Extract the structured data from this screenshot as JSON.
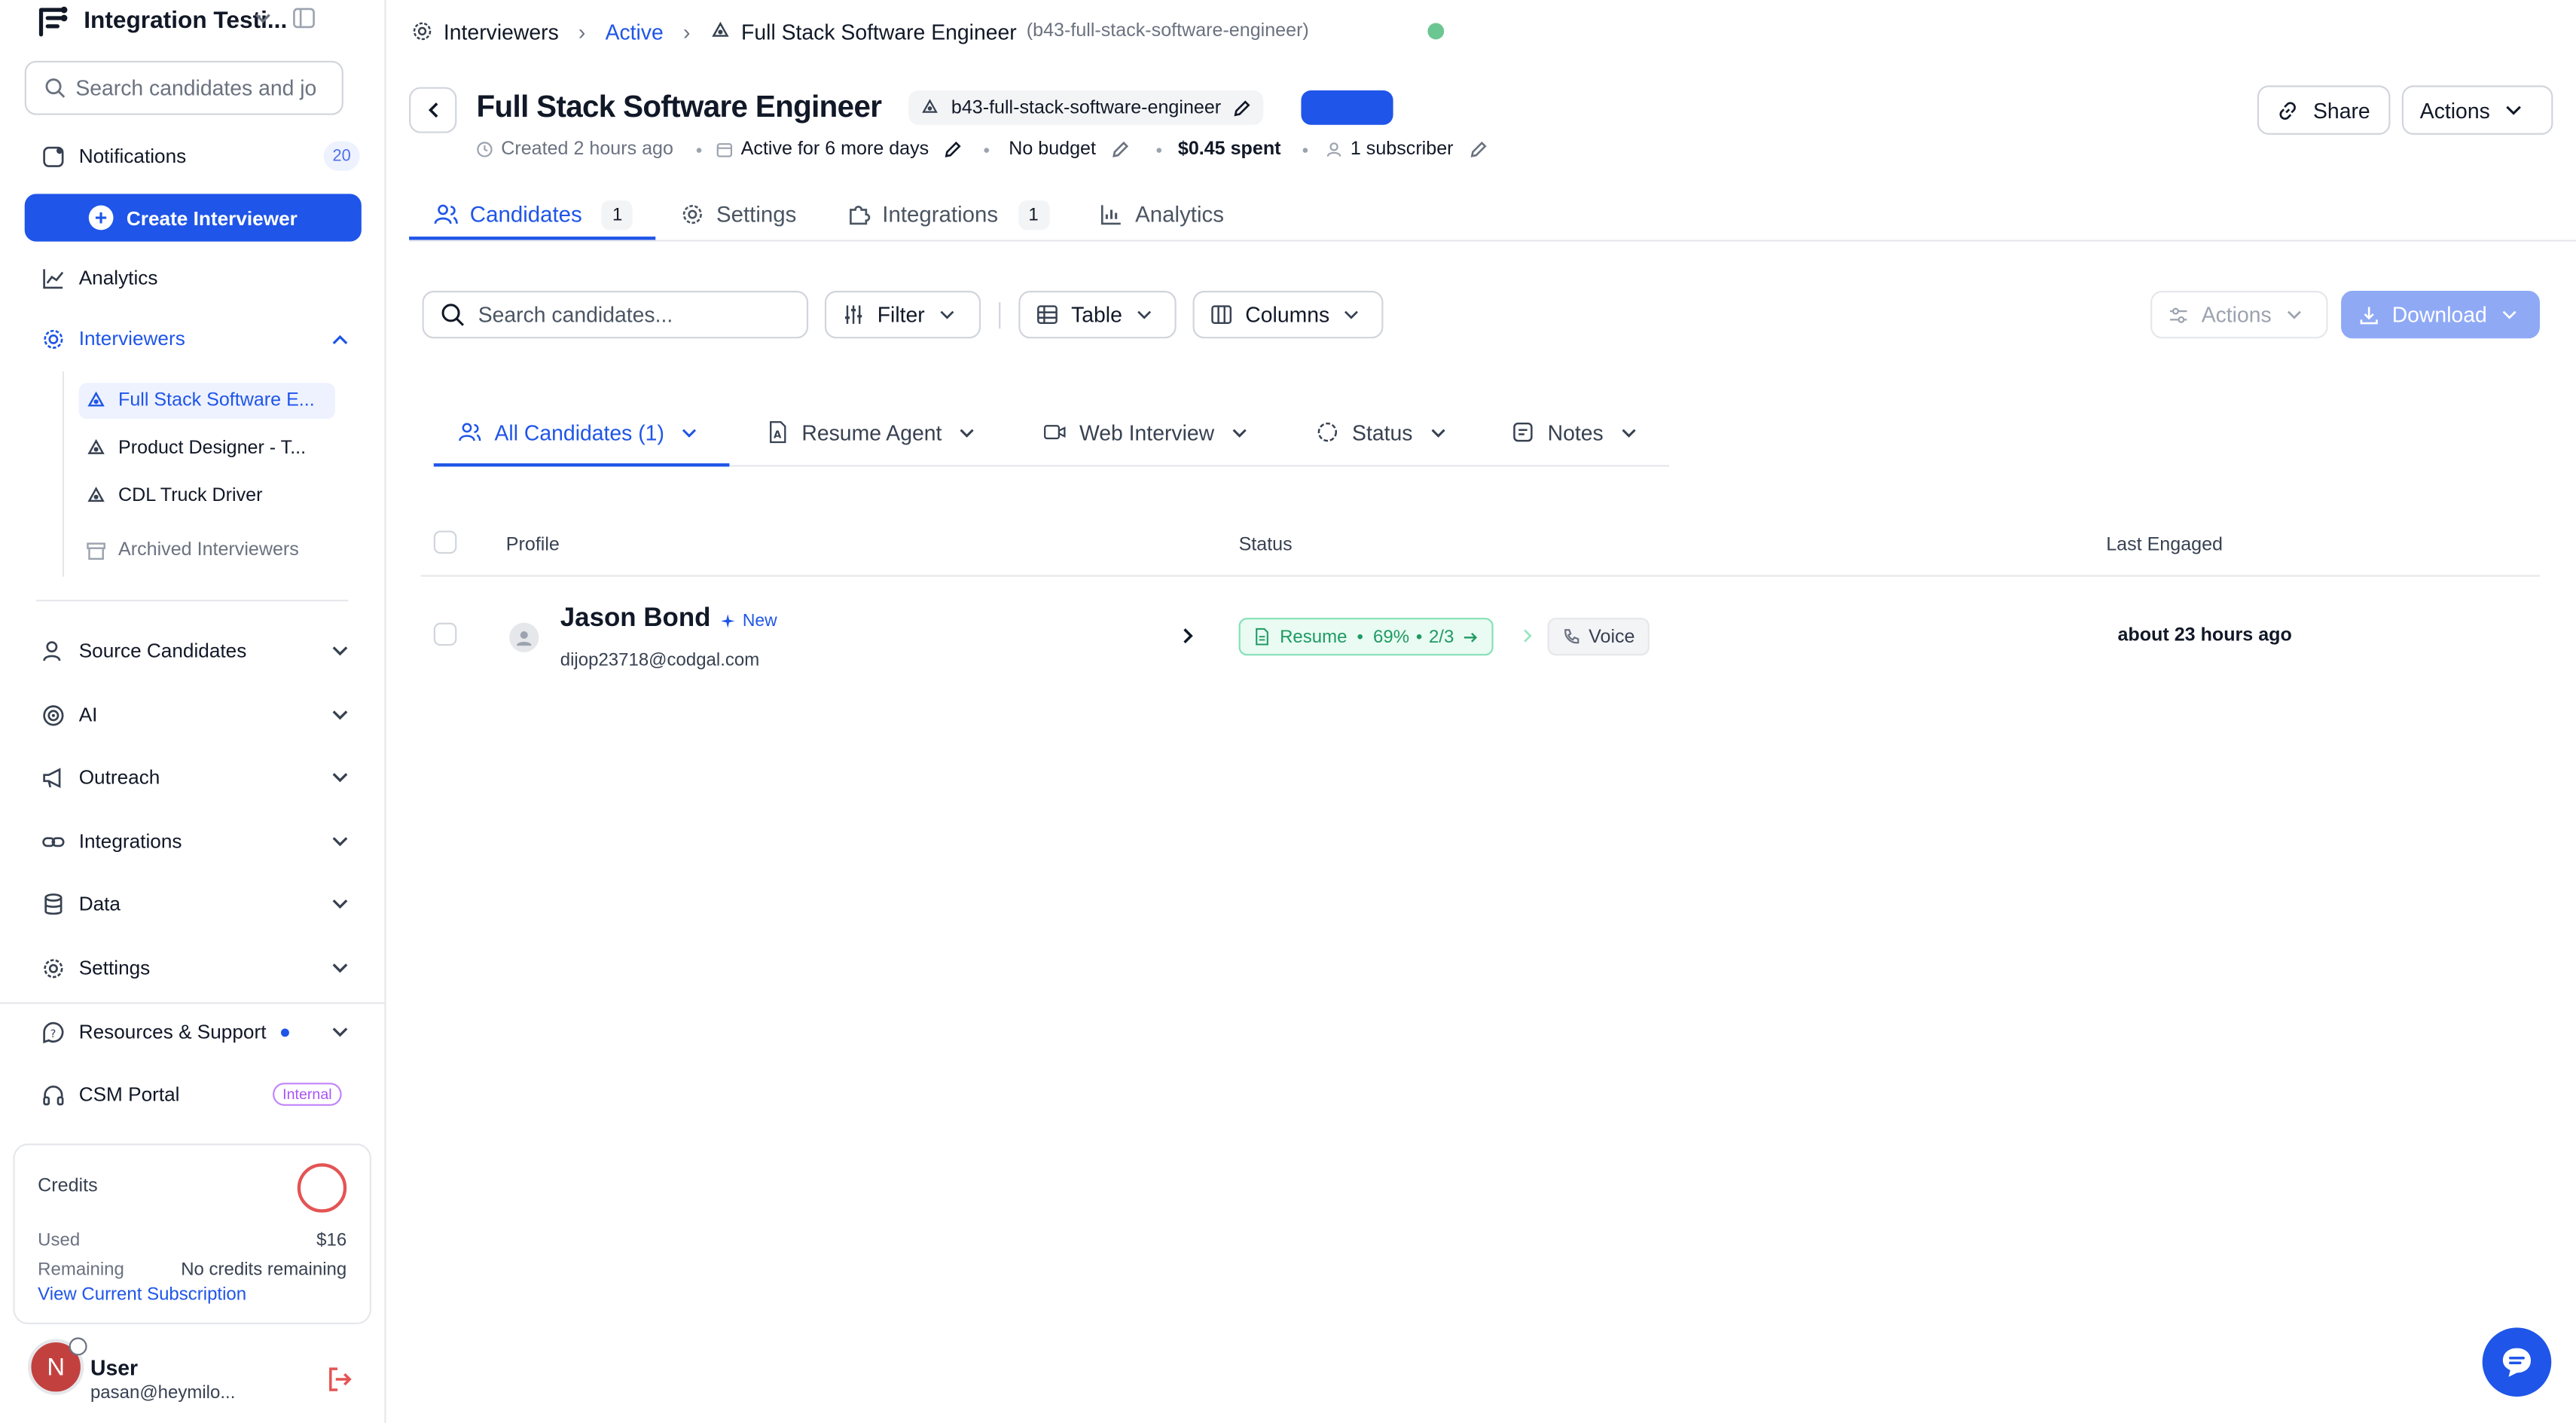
{
  "workspace": {
    "name": "Integration Testi..."
  },
  "sidebar": {
    "search_placeholder": "Search candidates and jo",
    "notifications": {
      "label": "Notifications",
      "count": "20"
    },
    "create_button": "Create Interviewer",
    "analytics": "Analytics",
    "interviewers": "Interviewers",
    "interviewer_items": [
      "Full Stack Software E...",
      "Product Designer - T...",
      "CDL Truck Driver"
    ],
    "archived": "Archived Interviewers",
    "groups": [
      "Source Candidates",
      "AI",
      "Outreach",
      "Integrations",
      "Data",
      "Settings"
    ],
    "resources": "Resources & Support",
    "csm_portal": "CSM Portal",
    "internal_badge": "Internal",
    "credits": {
      "title": "Credits",
      "used_label": "Used",
      "used_value": "$16",
      "remaining_label": "Remaining",
      "remaining_value": "No credits remaining",
      "link": "View Current Subscription"
    },
    "user": {
      "initial": "N",
      "name": "User",
      "email": "pasan@heymilo..."
    }
  },
  "breadcrumb": {
    "root": "Interviewers",
    "status": "Active",
    "current": "Full Stack Software Engineer",
    "slug": "(b43-full-stack-software-engineer)"
  },
  "header": {
    "title": "Full Stack Software Engineer",
    "slug": "b43-full-stack-software-engineer",
    "created": "Created 2 hours ago",
    "active_for": "Active for 6 more days",
    "budget": "No budget",
    "spent": "$0.45 spent",
    "subscribers": "1 subscriber",
    "share": "Share",
    "actions": "Actions"
  },
  "tabs": [
    {
      "label": "Candidates",
      "count": "1"
    },
    {
      "label": "Settings"
    },
    {
      "label": "Integrations",
      "count": "1"
    },
    {
      "label": "Analytics"
    }
  ],
  "toolbar": {
    "search_placeholder": "Search candidates...",
    "filter": "Filter",
    "table": "Table",
    "columns": "Columns",
    "actions": "Actions",
    "download": "Download"
  },
  "filter_tabs": [
    "All Candidates (1)",
    "Resume Agent",
    "Web Interview",
    "Status",
    "Notes"
  ],
  "table": {
    "headers": [
      "Profile",
      "Status",
      "Last Engaged"
    ],
    "rows": [
      {
        "name": "Jason Bond",
        "tag": "New",
        "email": "dijop23718@codgal.com",
        "resume_label": "Resume",
        "resume_score": "69%",
        "resume_progress": "2/3",
        "voice": "Voice",
        "last_engaged": "about 23 hours ago"
      }
    ]
  },
  "colors": {
    "accent": "#1f55e8",
    "status_green": "#6cc691",
    "resume_green": "#1f9a63",
    "avatar_red": "#c2413f"
  }
}
